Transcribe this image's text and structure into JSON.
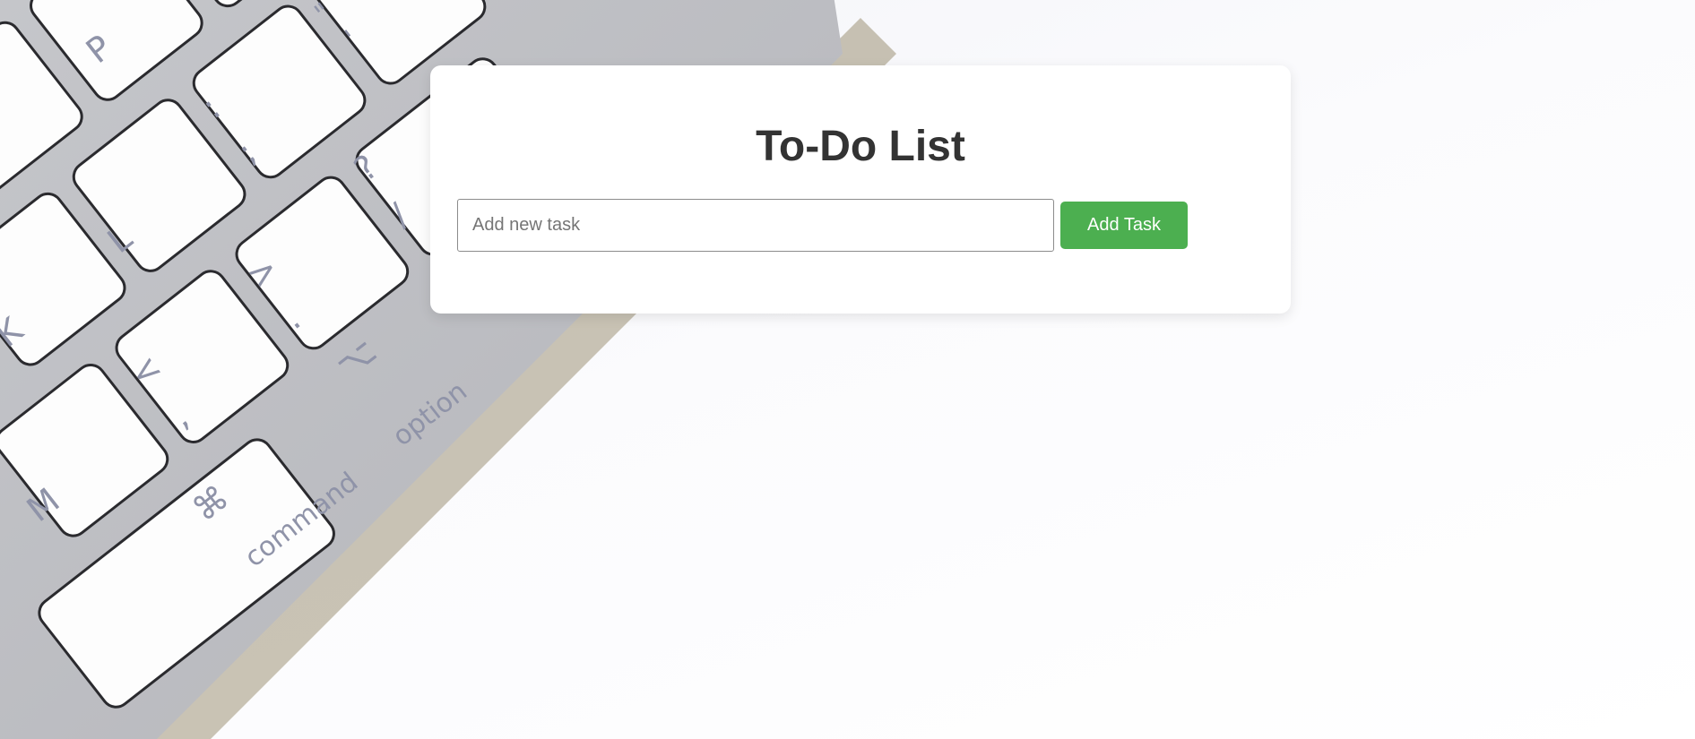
{
  "todo": {
    "title": "To-Do List",
    "input_placeholder": "Add new task",
    "input_value": "",
    "add_button_label": "Add Task"
  },
  "colors": {
    "add_button": "#4caf50",
    "title_text": "#333333",
    "card_background": "#ffffff"
  },
  "background": {
    "keyboard_keys": {
      "p": "P",
      "quote_top": "\"",
      "quote_bottom": "'",
      "semicolon_top": ":",
      "semicolon_bottom": ";",
      "l": "L",
      "question_top": "?",
      "question_bottom": "/",
      "k": "K",
      "greater_top": ">",
      "greater_bottom": ".",
      "less_top": "<",
      "less_bottom": ",",
      "m": "M",
      "command_symbol": "⌘",
      "command_label": "command",
      "option_symbol": "⌥",
      "option_label": "option"
    }
  }
}
